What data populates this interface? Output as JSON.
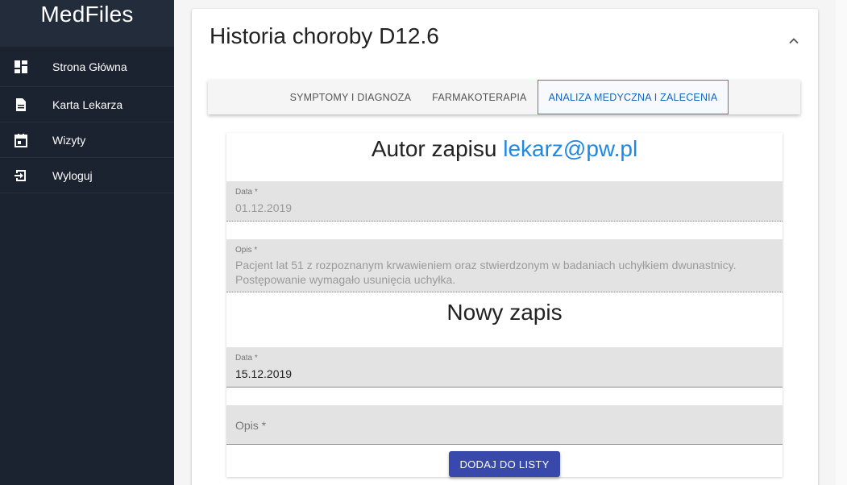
{
  "app": {
    "name": "MedFiles"
  },
  "sidebar": {
    "items": [
      {
        "label": "Strona Główna",
        "icon": "dashboard-icon"
      },
      {
        "label": "Karta Lekarza",
        "icon": "document-icon"
      },
      {
        "label": "Wizyty",
        "icon": "calendar-icon"
      },
      {
        "label": "Wyloguj",
        "icon": "logout-icon"
      }
    ]
  },
  "card": {
    "title": "Historia choroby D12.6",
    "collapse_icon": "chevron-up-icon"
  },
  "tabs": [
    {
      "label": "SYMPTOMY I DIAGNOZA",
      "active": false
    },
    {
      "label": "FARMAKOTERAPIA",
      "active": false
    },
    {
      "label": "ANALIZA MEDYCZNA I ZALECENIA",
      "active": true
    }
  ],
  "existing_entry": {
    "author_prefix": "Autor zapisu",
    "author_email": "lekarz@pw.pl",
    "date_label": "Data *",
    "date_value": "01.12.2019",
    "desc_label": "Opis *",
    "desc_line1": "Pacjent lat 51 z rozpoznanym krwawieniem oraz stwierdzonym w badaniach uchyłkiem dwunastnicy.",
    "desc_line2": "Postępowanie wymagało usunięcia uchyłka."
  },
  "new_entry": {
    "title": "Nowy zapis",
    "date_label": "Data *",
    "date_value": "15.12.2019",
    "desc_placeholder": "Opis *",
    "submit_label": "DODAJ DO LISTY"
  },
  "colors": {
    "sidebar_bg": "#1b2230",
    "accent": "#1e88e5",
    "button": "#3949ab"
  }
}
